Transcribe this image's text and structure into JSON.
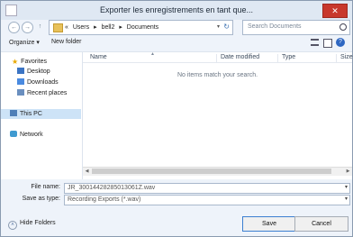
{
  "window": {
    "title": "Exporter les enregistrements en tant que...",
    "close_glyph": "✕"
  },
  "address": {
    "breadcrumbs": [
      "«",
      "Users",
      "▸",
      "bell2",
      "▸",
      "Documents"
    ],
    "dropdown_glyph": "▾",
    "refresh_glyph": "↻"
  },
  "search": {
    "placeholder": "Search Documents"
  },
  "nav_buttons": {
    "back": "←",
    "forward": "→",
    "up": "↑"
  },
  "toolbar": {
    "organize_label": "Organize ▾",
    "new_folder_label": "New folder",
    "help_glyph": "?"
  },
  "sidebar": {
    "favorites_label": "Favorites",
    "items": [
      {
        "label": "Desktop",
        "icon": "desktop-icon"
      },
      {
        "label": "Downloads",
        "icon": "downloads-icon"
      },
      {
        "label": "Recent places",
        "icon": "recent-places-icon"
      }
    ],
    "this_pc_label": "This PC",
    "network_label": "Network"
  },
  "file_list": {
    "columns": [
      "Name",
      "Date modified",
      "Type",
      "Size"
    ],
    "empty_message": "No items match your search."
  },
  "form": {
    "file_name_label": "File name:",
    "file_name_value": "JR_30014428285013061Z.wav",
    "save_as_type_label": "Save as type:",
    "save_as_type_value": "Recording Exports (*.wav)"
  },
  "footer": {
    "hide_folders_label": "Hide Folders",
    "save_label": "Save",
    "cancel_label": "Cancel"
  },
  "colors": {
    "accent": "#3c7fd1",
    "close": "#c8382c",
    "folder": "#e8c15a"
  }
}
